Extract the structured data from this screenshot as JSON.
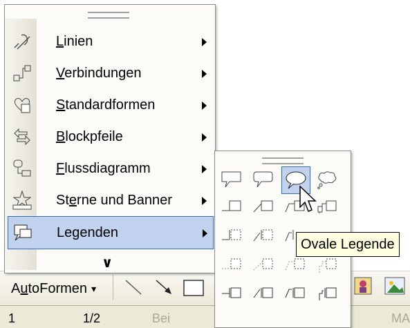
{
  "menu": {
    "items": [
      {
        "label_pre": "",
        "accel": "L",
        "label_post": "inien",
        "icon": "lines-icon"
      },
      {
        "label_pre": "",
        "accel": "V",
        "label_post": "erbindungen",
        "icon": "connectors-icon"
      },
      {
        "label_pre": "",
        "accel": "S",
        "label_post": "tandardformen",
        "icon": "basic-shapes-icon"
      },
      {
        "label_pre": "",
        "accel": "B",
        "label_post": "lockpfeile",
        "icon": "block-arrows-icon"
      },
      {
        "label_pre": "",
        "accel": "F",
        "label_post": "lussdiagramm",
        "icon": "flowchart-icon"
      },
      {
        "label_pre": "St",
        "accel": "e",
        "label_post": "rne und Banner",
        "icon": "stars-banners-icon"
      },
      {
        "label_pre": "Le",
        "accel": "g",
        "label_post": "enden",
        "icon": "callouts-icon"
      }
    ],
    "expand_glyph": "¥"
  },
  "submenu": {
    "tooltip": "Ovale Legende",
    "selected_shape": "oval-callout"
  },
  "toolbar": {
    "autoformen_pre": "A",
    "autoformen_accel": "u",
    "autoformen_post": "toFormen",
    "autoformen_arrow": "▾"
  },
  "status": {
    "page": "1",
    "section": "1/2",
    "at": "Bei",
    "extra": "MA"
  }
}
